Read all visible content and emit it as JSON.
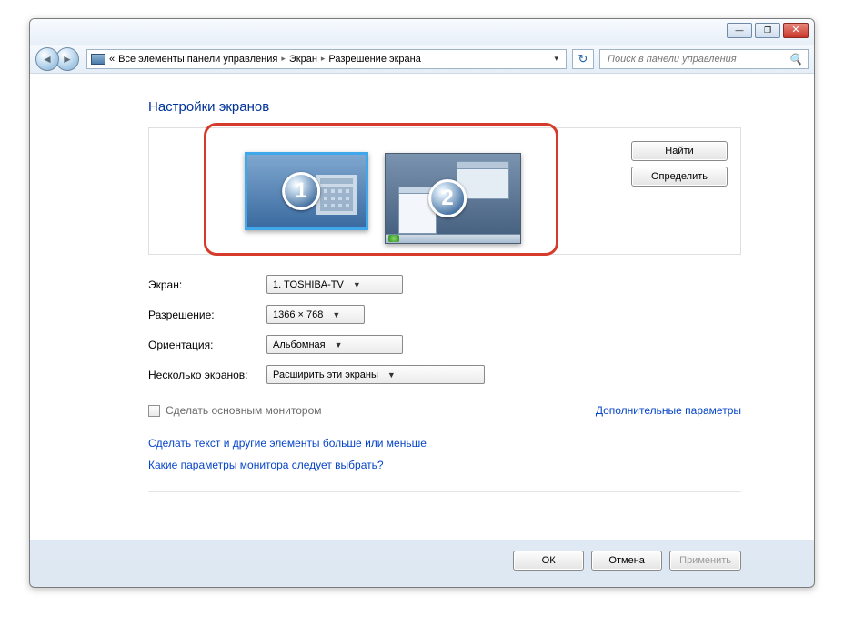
{
  "titlebar": {
    "minimize": "—",
    "maximize": "❐",
    "close": "✕"
  },
  "breadcrumb": {
    "prefix": "«",
    "items": [
      "Все элементы панели управления",
      "Экран",
      "Разрешение экрана"
    ]
  },
  "search": {
    "placeholder": "Поиск в панели управления"
  },
  "heading": "Настройки экранов",
  "monitors": {
    "one": "1",
    "two": "2",
    "find": "Найти",
    "detect": "Определить"
  },
  "form": {
    "screen": {
      "label": "Экран:",
      "value": "1. TOSHIBA-TV"
    },
    "resolution": {
      "label": "Разрешение:",
      "value": "1366 × 768"
    },
    "orientation": {
      "label": "Ориентация:",
      "value": "Альбомная"
    },
    "multi": {
      "label": "Несколько экранов:",
      "value": "Расширить эти экраны"
    }
  },
  "make_main": "Сделать основным монитором",
  "advanced": "Дополнительные параметры",
  "links": {
    "text_bigger": "Сделать текст и другие элементы больше или меньше",
    "which_settings": "Какие параметры монитора следует выбрать?"
  },
  "footer": {
    "ok": "ОК",
    "cancel": "Отмена",
    "apply": "Применить"
  }
}
